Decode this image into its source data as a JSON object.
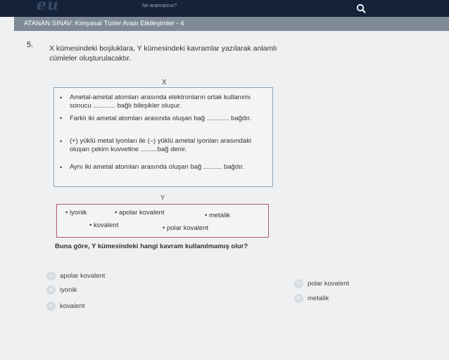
{
  "header": {
    "logo_text": "eu",
    "search_placeholder": "Ne aramıştınız?"
  },
  "exam": {
    "title": "ATANAN SINAV: Kimyasal Türler Arası Etkileşimler - 4"
  },
  "question": {
    "number": "5.",
    "text": "X kümesindeki boşluklara, Y kümesindeki kavramlar yazılarak anlamlı cümleler oluşturulacaktır.",
    "set_x_label": "X",
    "set_x_items": [
      "Ametal-ametal atomları arasında elektronların ortak kullanımı sonucu ............ bağlı bileşikler oluşur.",
      "Farklı iki ametal atomları arasında oluşan bağ ............ bağdır.",
      "(+) yüklü metal iyonları ile (–) yüklü ametal iyonları arasındaki oluşan çekim kuvvetine .........bağ denir.",
      "Aynı iki ametal atomları arasında oluşan bağ .......... bağdır."
    ],
    "set_y_label": "Y",
    "set_y_items": [
      "• iyonik",
      "• apolar kovalent",
      "• metalik",
      "• kovalent",
      "• polar kovalent"
    ],
    "stem": "Buna göre, Y kümesindeki hangi kavram kullanılmamış olur?",
    "options": [
      {
        "letter": "A",
        "text": "apolar kovalent"
      },
      {
        "letter": "B",
        "text": "iyonik"
      },
      {
        "letter": "C",
        "text": "kovalent"
      },
      {
        "letter": "D",
        "text": "polar kovalent"
      },
      {
        "letter": "E",
        "text": "metalik"
      }
    ]
  },
  "colors": {
    "topbar": "#15233a",
    "titlebar": "#7e8b97",
    "box_x_border": "#8fa6bb",
    "box_y_border": "#b05a70"
  },
  "icons": {
    "search": "search-icon"
  }
}
